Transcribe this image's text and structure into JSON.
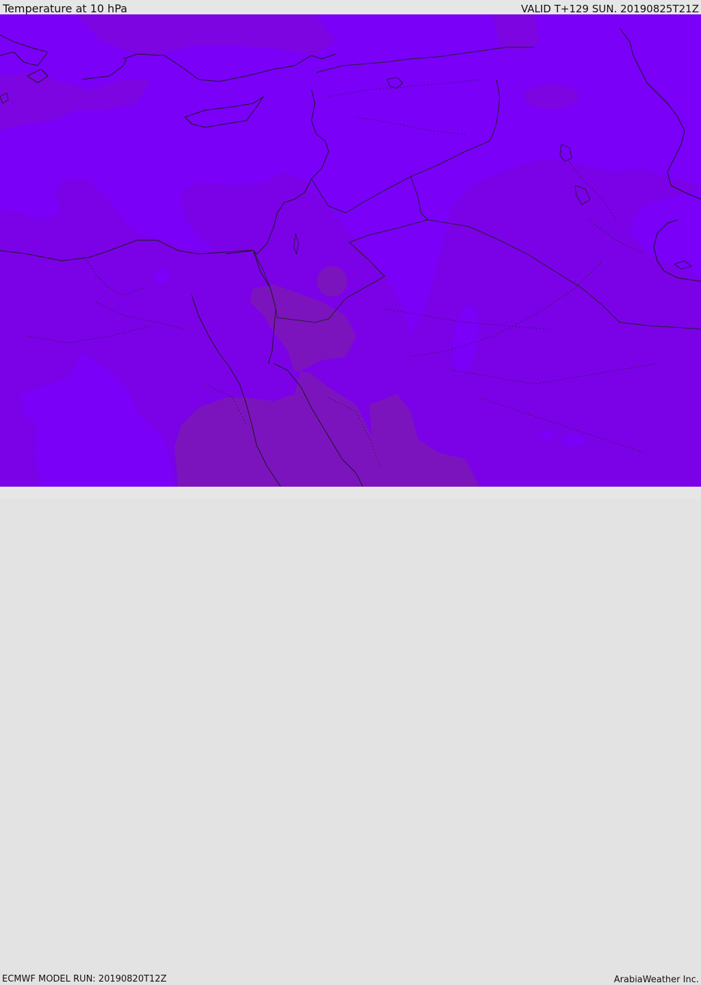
{
  "header": {
    "title": "Temperature at 10 hPa",
    "valid": "VALID T+129 SUN. 20190825T21Z"
  },
  "footer": {
    "model_run": "ECMWF MODEL RUN: 20190820T12Z",
    "credit": "ArabiaWeather Inc."
  },
  "colors": {
    "warm_field": "#7a00f7",
    "mid_field": "#7d05e2",
    "cool_field": "#7c14bd",
    "coastline": "#1a1a1a",
    "border": "#222222"
  }
}
